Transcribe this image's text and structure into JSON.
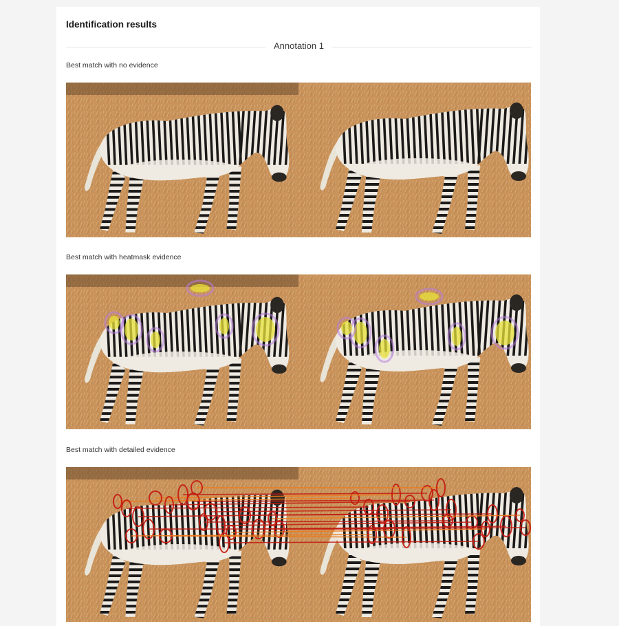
{
  "panel": {
    "title": "Identification results",
    "annotation_label": "Annotation 1"
  },
  "sections": [
    {
      "label": "Best match with no evidence",
      "evidence": "none"
    },
    {
      "label": "Best match with heatmask evidence",
      "evidence": "heatmask"
    },
    {
      "label": "Best match with detailed evidence",
      "evidence": "detailed"
    }
  ],
  "colors": {
    "ground": "#c8925a",
    "stripe_dark": "#1c1a18",
    "body_light": "#eeeae2",
    "heat_yellow": "#e8e23a",
    "heat_purple": "#b67be0",
    "match_red": "#c41a10",
    "match_orange": "#f07a1a"
  }
}
